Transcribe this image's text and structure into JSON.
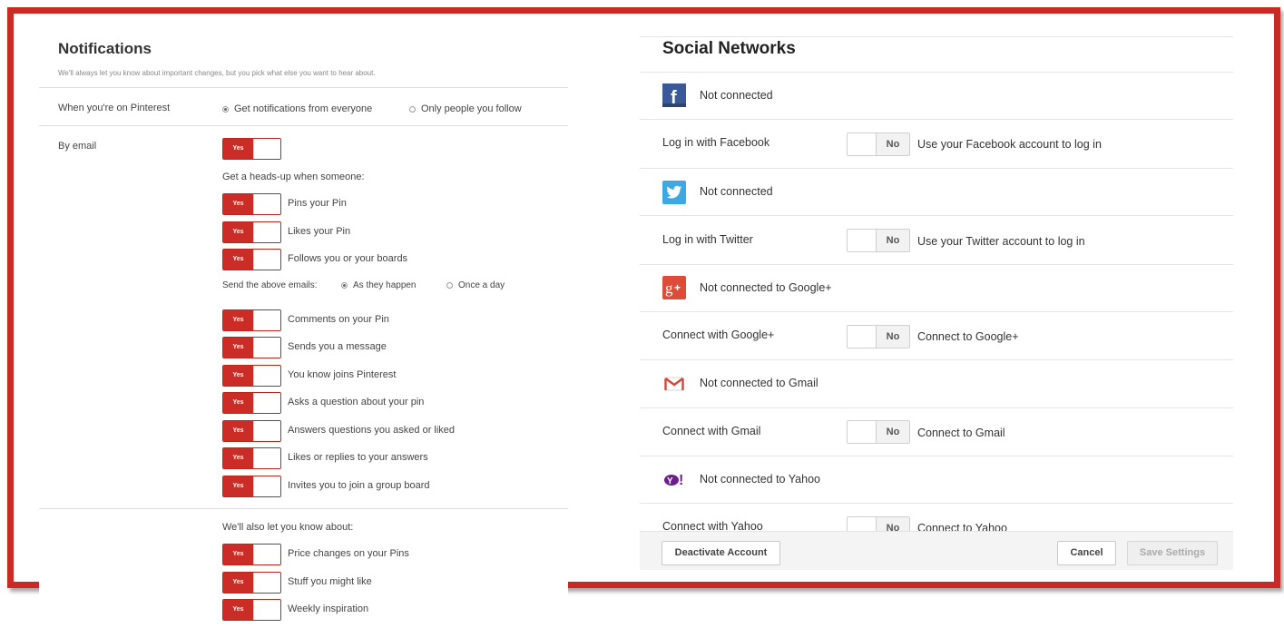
{
  "notifications": {
    "title": "Notifications",
    "subtitle": "We'll always let you know about important changes, but you pick what else you want to hear about.",
    "on_pinterest": {
      "label": "When you're on Pinterest",
      "options": [
        "Get notifications from everyone",
        "Only people you follow"
      ],
      "selected": "Get notifications from everyone"
    },
    "by_email": {
      "label": "By email",
      "toggle": "Yes"
    },
    "heads_up_heading": "Get a heads-up when someone:",
    "heads_up_items": [
      {
        "label": "Pins your Pin",
        "toggle": "Yes"
      },
      {
        "label": "Likes your Pin",
        "toggle": "Yes"
      },
      {
        "label": "Follows you or your boards",
        "toggle": "Yes"
      }
    ],
    "send_emails": {
      "label": "Send the above emails:",
      "options": [
        "As they happen",
        "Once a day"
      ],
      "selected": "As they happen"
    },
    "more_items": [
      {
        "label": "Comments on your Pin",
        "toggle": "Yes"
      },
      {
        "label": "Sends you a message",
        "toggle": "Yes"
      },
      {
        "label": "You know joins Pinterest",
        "toggle": "Yes"
      },
      {
        "label": "Asks a question about your pin",
        "toggle": "Yes"
      },
      {
        "label": "Answers questions you asked or liked",
        "toggle": "Yes"
      },
      {
        "label": "Likes or replies to your answers",
        "toggle": "Yes"
      },
      {
        "label": "Invites you to join a group board",
        "toggle": "Yes"
      }
    ],
    "also_heading": "We'll also let you know about:",
    "also_items": [
      {
        "label": "Price changes on your Pins",
        "toggle": "Yes"
      },
      {
        "label": "Stuff you might like",
        "toggle": "Yes"
      },
      {
        "label": "Weekly inspiration",
        "toggle": "Yes"
      }
    ]
  },
  "social": {
    "title": "Social Networks",
    "networks": [
      {
        "icon": "facebook-icon",
        "status": "Not connected",
        "label": "Log in with Facebook",
        "toggle": "No",
        "desc": "Use your Facebook account to log in"
      },
      {
        "icon": "twitter-icon",
        "status": "Not connected",
        "label": "Log in with Twitter",
        "toggle": "No",
        "desc": "Use your Twitter account to log in"
      },
      {
        "icon": "google-plus-icon",
        "status": "Not connected to Google+",
        "label": "Connect with Google+",
        "toggle": "No",
        "desc": "Connect to Google+"
      },
      {
        "icon": "gmail-icon",
        "status": "Not connected to Gmail",
        "label": "Connect with Gmail",
        "toggle": "No",
        "desc": "Connect to Gmail"
      },
      {
        "icon": "yahoo-icon",
        "status": "Not connected to Yahoo",
        "label": "Connect with Yahoo",
        "toggle": "No",
        "desc": "Connect to Yahoo"
      }
    ],
    "footer": {
      "deactivate": "Deactivate Account",
      "cancel": "Cancel",
      "save": "Save Settings"
    }
  },
  "colors": {
    "frame": "#c92a26",
    "toggle_yes": "#cb2c25",
    "facebook": "#3b5998",
    "twitter": "#3ea8e5",
    "google_plus": "#dd4b39",
    "gmail": "#d44638",
    "yahoo": "#6d1e8d"
  }
}
